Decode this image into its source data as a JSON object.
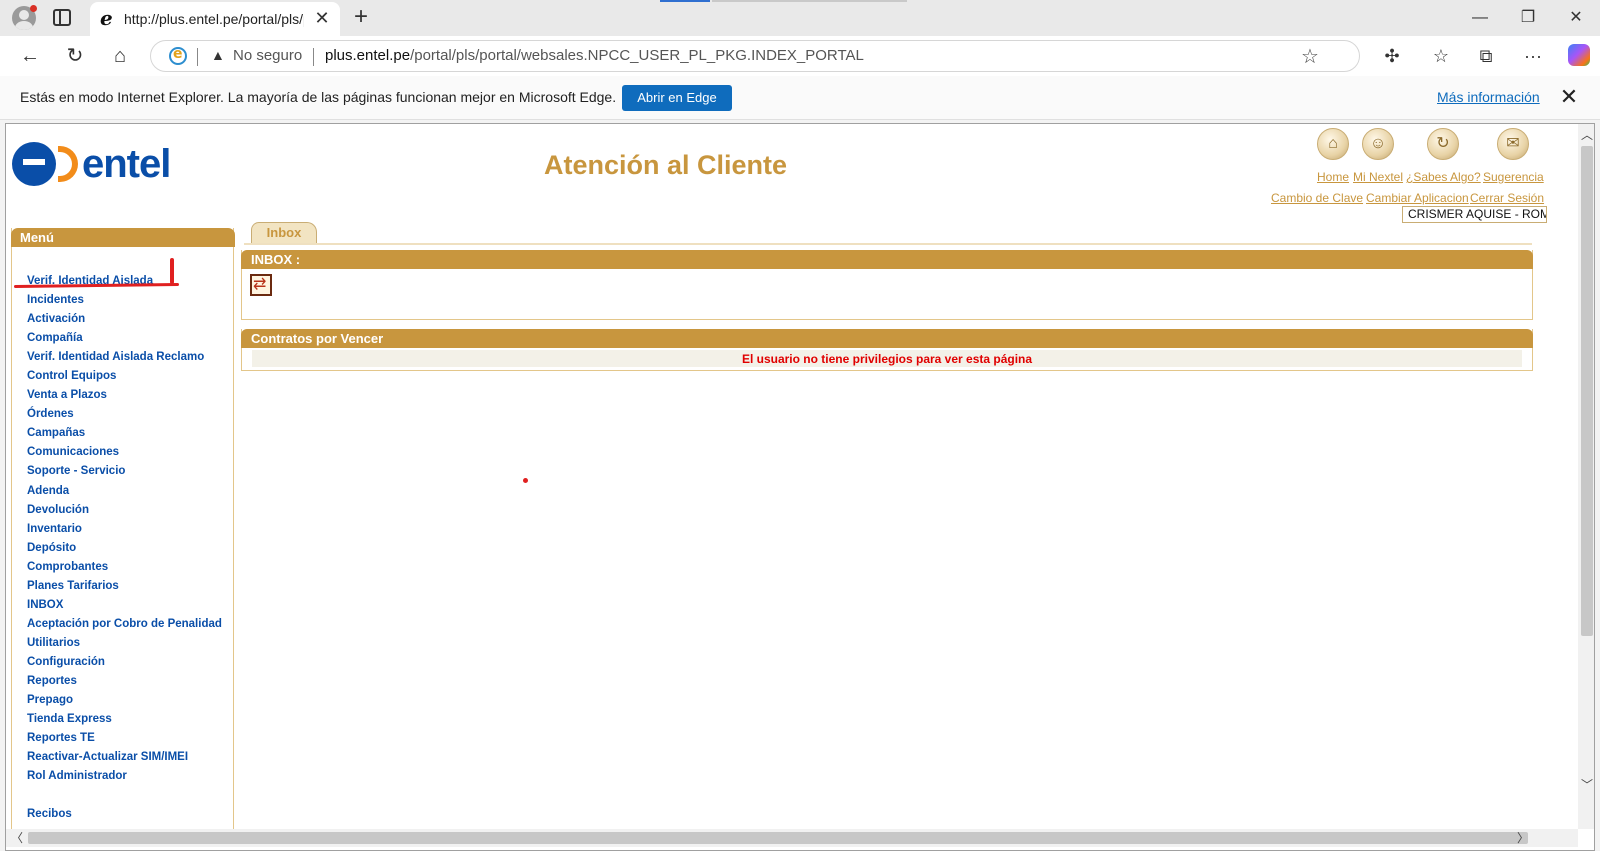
{
  "browser": {
    "tab_title": "http://plus.entel.pe/portal/pls/portal/websales",
    "tab_close": "✕",
    "new_tab": "+",
    "window_controls": {
      "minimize": "—",
      "restore": "❐",
      "close": "✕"
    },
    "nav": {
      "back": "←",
      "refresh": "↻",
      "home": "⌂"
    },
    "security_warning_icon": "▲",
    "security_text": "No seguro",
    "url_host": "plus.entel.pe",
    "url_path": "/portal/pls/portal/websales.NPCC_USER_PL_PKG.INDEX_PORTAL",
    "favorite_icon": "☆",
    "toolbar_icons": [
      "extensions-icon",
      "favorites-icon",
      "collections-icon",
      "more-icon",
      "copilot-icon"
    ],
    "toolbar_glyphs": {
      "extensions": "✣",
      "favorites": "☆",
      "collections": "⧉",
      "more": "···"
    }
  },
  "infobar": {
    "message": "Estás en modo Internet Explorer. La mayoría de las páginas funcionan mejor en Microsoft Edge.",
    "button_label": "Abrir en Edge",
    "link_label": "Más información",
    "close": "✕"
  },
  "header": {
    "brand": "entel",
    "title": "Atención al Cliente",
    "icons": [
      {
        "name": "home-icon",
        "glyph": "⌂"
      },
      {
        "name": "mi-nextel-icon",
        "glyph": "☺"
      },
      {
        "name": "sabes-algo-icon",
        "glyph": "↻"
      },
      {
        "name": "sugerencia-icon",
        "glyph": "✉"
      }
    ],
    "links_row1": [
      "Home",
      "Mi Nextel",
      "¿Sabes Algo?",
      "Sugerencia"
    ],
    "links_row2": [
      "Cambio de Clave",
      "Cambiar Aplicacion",
      "Cerrar Sesión"
    ],
    "user": "CRISMER AQUISE - ROM"
  },
  "menu": {
    "title": "Menú",
    "items": [
      "Verif. Identidad Aislada",
      "Incidentes",
      "Activación",
      "Compañía",
      "Verif. Identidad Aislada Reclamo",
      "Control Equipos",
      "Venta a Plazos",
      "Órdenes",
      "Campañas",
      "Comunicaciones",
      "Soporte - Servicio",
      "Adenda",
      "Devolución",
      "Inventario",
      "Depósito",
      "Comprobantes",
      "Planes Tarifarios",
      "INBOX",
      "Aceptación por Cobro de Penalidad",
      "Utilitarios",
      "Configuración",
      "Reportes",
      "Prepago",
      "Tienda Express",
      "Reportes TE",
      "Reactivar-Actualizar SIM/IMEI",
      "Rol Administrador",
      "",
      "Recibos"
    ]
  },
  "content": {
    "tab_label": "Inbox",
    "inbox_title": "INBOX :",
    "contracts_title": "Contratos por Vencer",
    "contracts_error": "El usuario no tiene privilegios para ver esta página"
  },
  "colors": {
    "accent_gold": "#c8963e",
    "menu_link_blue": "#0a4ea8",
    "error_red": "#e00000",
    "edge_button_blue": "#0f6cbd",
    "annotation_red": "#e02020"
  }
}
